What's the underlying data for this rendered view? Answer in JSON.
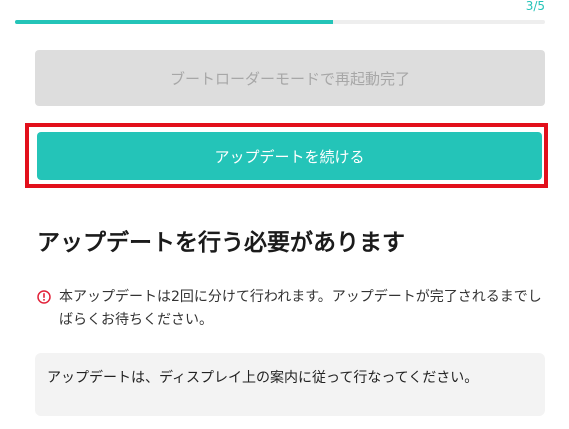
{
  "progress": {
    "step_label": "3/5",
    "fraction": 0.6
  },
  "buttons": {
    "reboot_complete_label": "ブートローダーモードで再起動完了",
    "continue_label": "アップデートを続ける"
  },
  "main": {
    "heading": "アップデートを行う必要があります",
    "notice_text": "本アップデートは2回に分けて行われます。アップデートが完了されるまでしばらくお待ちください。",
    "info_text": "アップデートは、ディスプレイ上の案内に従って行なってください。"
  },
  "colors": {
    "accent": "#24c4b8",
    "highlight": "#e20f1b",
    "notice_icon": "#e2233a",
    "disabled_bg": "#dddddd"
  },
  "icons": {
    "notice": "info-circle-icon"
  }
}
